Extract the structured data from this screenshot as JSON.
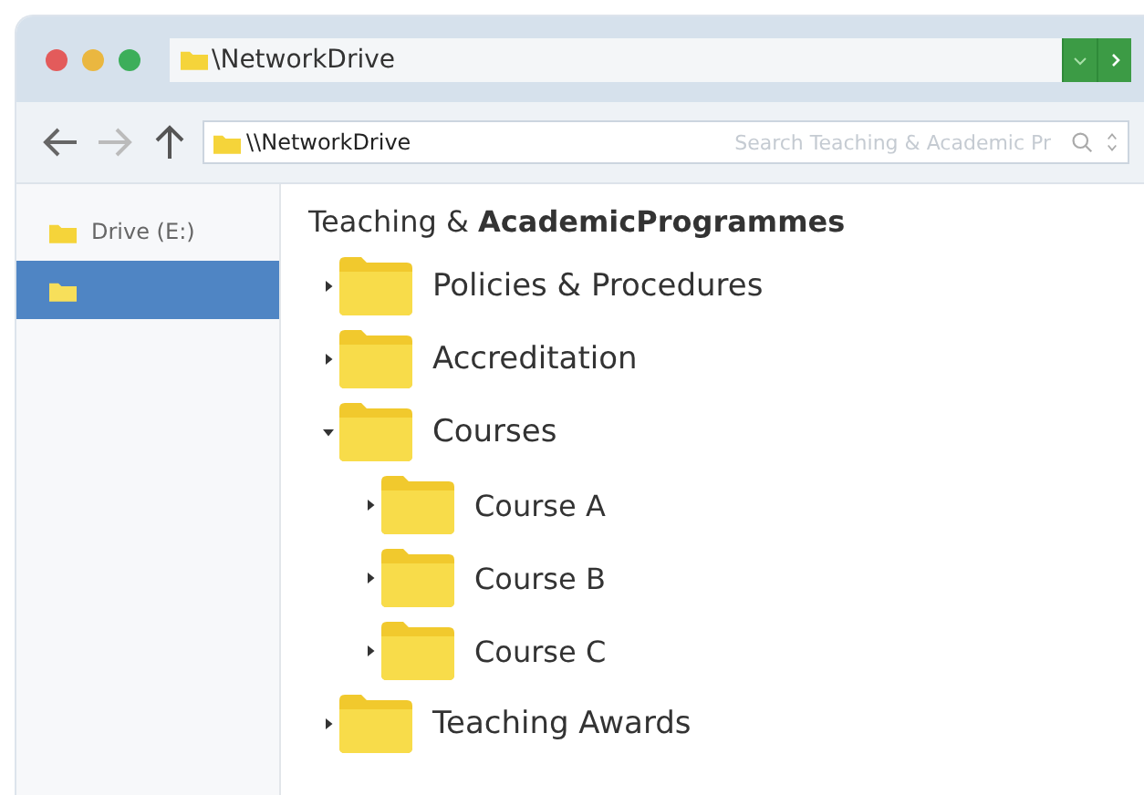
{
  "title_bar": {
    "path": "\\NetworkDrive"
  },
  "toolbar": {
    "address": "\\\\NetworkDrive",
    "search": {
      "placeholder": "Search Teaching & Academic Pr"
    }
  },
  "sidebar": {
    "items": [
      {
        "label": "Drive (E:)",
        "selected": false
      },
      {
        "selected": true
      }
    ]
  },
  "main": {
    "heading": "Teaching & **AcademicProgrammes**",
    "tree": [
      {
        "label": "Policies & Procedures",
        "expanded": false
      },
      {
        "label": "Accreditation",
        "expanded": false
      },
      {
        "label": "Courses",
        "expanded": true,
        "children": [
          {
            "label": "Course A",
            "expanded": false
          },
          {
            "label": "Course B",
            "expanded": false
          },
          {
            "label": "Course C",
            "expanded": false
          }
        ]
      },
      {
        "label": "Teaching Awards",
        "expanded": false
      }
    ]
  }
}
